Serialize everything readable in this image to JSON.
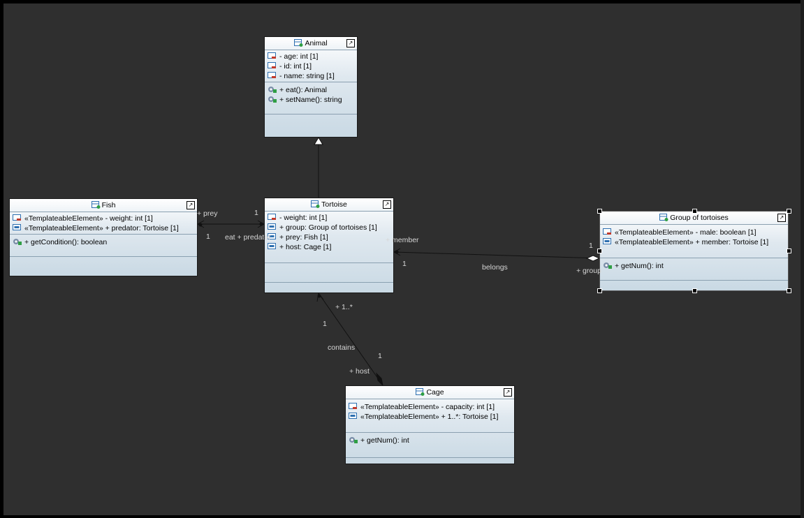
{
  "classes": {
    "animal": {
      "name": "Animal",
      "attributes": [
        "- age: int [1]",
        "- id: int [1]",
        "- name: string [1]"
      ],
      "operations": [
        "+ eat(): Animal",
        "+ setName(): string"
      ]
    },
    "fish": {
      "name": "Fish",
      "attributes": [
        "«TemplateableElement»  - weight: int [1]",
        "«TemplateableElement»  + predator: Tortoise [1]"
      ],
      "operations": [
        "+ getCondition(): boolean"
      ]
    },
    "tortoise": {
      "name": "Tortoise",
      "attributes": [
        "- weight: int [1]",
        "+ group: Group of tortoises [1]",
        "+ prey: Fish [1]",
        "+ host: Cage [1]"
      ],
      "operations": []
    },
    "group": {
      "name": "Group of tortoises",
      "attributes": [
        "«TemplateableElement»  - male: boolean [1]",
        "«TemplateableElement»  + member: Tortoise [1]"
      ],
      "operations": [
        "+ getNum(): int"
      ]
    },
    "cage": {
      "name": "Cage",
      "attributes": [
        "«TemplateableElement»  - capacity: int [1]",
        "«TemplateableElement»  + 1..*: Tortoise [1]"
      ],
      "operations": [
        "+ getNum(): int"
      ]
    }
  },
  "labels": {
    "prey_role": "+ prey",
    "fish_mult_1": "1",
    "tort_mult_1a": "1",
    "eat_predator": "eat + predator",
    "member_role": "+ member",
    "member_mult": "1",
    "belongs": "belongs",
    "group_mult": "1",
    "group_role": "+ group",
    "one_many_role": "+ 1..*",
    "contains_mult_1": "1",
    "contains": "contains",
    "host_mult": "1",
    "host_role": "+ host"
  },
  "colors": {
    "canvas": "#2f2f2f",
    "line": "#111111",
    "private_icon": "#c0392b",
    "public_icon": "#2d6fb0"
  }
}
